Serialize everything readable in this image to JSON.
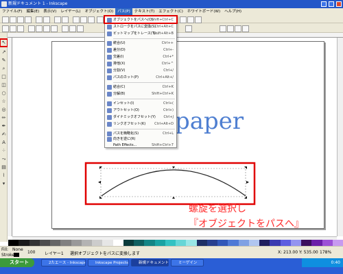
{
  "window": {
    "title": "新規ドキュメント 1 - Inkscape"
  },
  "menubar": [
    "ファイル(F)",
    "編集(E)",
    "表示(V)",
    "レイヤー(L)",
    "オブジェクト(O)",
    "パス(P)",
    "テキスト(T)",
    "エフェクト(C)",
    "ホワイトボード(W)",
    "ヘルプ(H)"
  ],
  "path_menu": {
    "items": [
      {
        "label": "オブジェクトをパスへ(O)",
        "shortcut": "Shift+Ctrl+C"
      },
      {
        "label": "ストロークをパスに変換(S)",
        "shortcut": "Ctrl+Alt+C"
      },
      {
        "label": "ビットマップをトレース(T)...",
        "shortcut": "Shift+Alt+B"
      },
      {
        "label": "統合(U)",
        "shortcut": "Ctrl++"
      },
      {
        "label": "差分(D)",
        "shortcut": "Ctrl+-"
      },
      {
        "label": "交差(I)",
        "shortcut": "Ctrl+*"
      },
      {
        "label": "排他(X)",
        "shortcut": "Ctrl+^"
      },
      {
        "label": "分割(V)",
        "shortcut": "Ctrl+/"
      },
      {
        "label": "パスのカット(P)",
        "shortcut": "Ctrl+Alt+/"
      },
      {
        "label": "結合(C)",
        "shortcut": "Ctrl+K"
      },
      {
        "label": "分解(B)",
        "shortcut": "Shift+Ctrl+K"
      },
      {
        "label": "インセット(I)",
        "shortcut": "Ctrl+("
      },
      {
        "label": "アウトセット(O)",
        "shortcut": "Ctrl+)"
      },
      {
        "label": "ダイナミックオフセット(Y)",
        "shortcut": "Ctrl+J"
      },
      {
        "label": "リンクオフセット(K)",
        "shortcut": "Ctrl+Alt+D"
      },
      {
        "label": "パスを簡略化(S)",
        "shortcut": "Ctrl+L"
      },
      {
        "label": "向きを逆に(R)",
        "shortcut": ""
      },
      {
        "label": "Path Effects...",
        "shortcut": "Shift+Ctrl+7"
      }
    ]
  },
  "canvas": {
    "text": "paper"
  },
  "annotation": {
    "line1": "螺旋を選択し",
    "line2": "『オブジェクトをパスへ』"
  },
  "status": {
    "fill_label": "Fill:",
    "stroke_label": "Stroke:",
    "fill_value": "None",
    "opacity": "100",
    "layer": "レイヤー1",
    "message": "選択オブジェクトをパスに変換します",
    "coords": "X: 213.00  Y: 535.00",
    "zoom": "178%"
  },
  "taskbar": {
    "start": "スタート",
    "items": [
      "2たエース - Inkscape",
      "Inkscape Projects",
      "新規ドキュメント 1",
      "ミーゲイン"
    ],
    "clock": "0:40"
  },
  "colors": {
    "accent_red": "#e00000",
    "menu_highlight": "#316ac5",
    "paper_text": "#4f7fd1",
    "title_blue": "#2457c8"
  }
}
